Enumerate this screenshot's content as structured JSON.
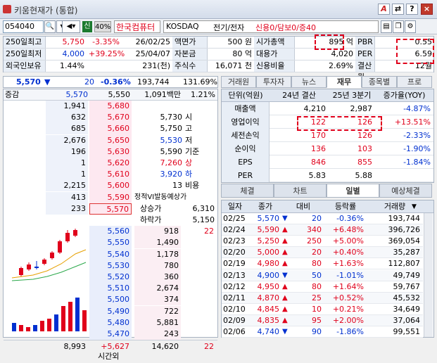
{
  "window": {
    "title": "키움현재가 (통합)",
    "buttons": [
      "A",
      "?",
      "×"
    ]
  },
  "toolbar": {
    "code": "054040",
    "market_tag": "신",
    "margin": "40%",
    "name": "한국컴퓨터",
    "market": "KOSDAQ",
    "sector": "전기/전자",
    "credit": "신용0/담보0/증40"
  },
  "info_rows": [
    {
      "c1": "250일최고",
      "c2": "5,750",
      "c3": "-3.35%",
      "c4": "26/02/25",
      "c5": "액면가",
      "c6": "500 원",
      "c7": "시가총액",
      "c8": "895 억",
      "c9": "PBR",
      "c10": "0.55"
    },
    {
      "c1": "250일최저",
      "c2": "4,000",
      "c3": "+39.25%",
      "c4": "25/04/07",
      "c5": "자본금",
      "c6": "80 억",
      "c7": "대용가",
      "c8": "4,020",
      "c9": "PER",
      "c10": "6.59"
    },
    {
      "c1": "외국인보유",
      "c2": "1.44%",
      "c3": "",
      "c4": "231(천)",
      "c5": "주식수",
      "c6": "16,071 천",
      "c7": "신용비율",
      "c8": "2.69%",
      "c9": "결산월",
      "c10": "12월"
    }
  ],
  "price_bar": {
    "price": "5,570",
    "arrow": "▼",
    "change": "20",
    "rate": "-0.36%",
    "volume": "193,744",
    "vol_rate": "131.69%"
  },
  "orderbook": {
    "head": [
      "증감",
      "5,570",
      "5,550",
      "1,091백만",
      "1.21%"
    ],
    "sells": [
      {
        "qty": "1,941",
        "price": "5,680"
      },
      {
        "qty": "632",
        "price": "5,670"
      },
      {
        "qty": "685",
        "price": "5,660"
      },
      {
        "qty": "2,676",
        "price": "5,650"
      },
      {
        "qty": "196",
        "price": "5,630"
      },
      {
        "qty": "1",
        "price": "5,620"
      },
      {
        "qty": "1",
        "price": "5,610"
      },
      {
        "qty": "2,215",
        "price": "5,600"
      },
      {
        "qty": "413",
        "price": "5,590"
      },
      {
        "qty": "233",
        "price": "5,570"
      }
    ],
    "summary": [
      {
        "label": "시",
        "value": "5,730"
      },
      {
        "label": "고",
        "value": "5,750"
      },
      {
        "label": "저",
        "value": "5,530"
      },
      {
        "label": "기준",
        "value": "5,590"
      },
      {
        "label": "상",
        "value": "7,260"
      },
      {
        "label": "하",
        "value": "3,920"
      },
      {
        "label": "비용",
        "value": "13"
      }
    ],
    "vi": {
      "title": "정적VI발동예상가",
      "up_label": "상승가",
      "up": "6,310",
      "down_label": "하락가",
      "down": "5,150"
    },
    "buys": [
      {
        "price": "5,560",
        "qty": "918",
        "extra": "22"
      },
      {
        "price": "5,550",
        "qty": "1,490",
        "extra": ""
      },
      {
        "price": "5,540",
        "qty": "1,178",
        "extra": ""
      },
      {
        "price": "5,530",
        "qty": "780",
        "extra": ""
      },
      {
        "price": "5,520",
        "qty": "360",
        "extra": ""
      },
      {
        "price": "5,510",
        "qty": "2,674",
        "extra": ""
      },
      {
        "price": "5,500",
        "qty": "374",
        "extra": ""
      },
      {
        "price": "5,490",
        "qty": "722",
        "extra": ""
      },
      {
        "price": "5,480",
        "qty": "5,881",
        "extra": ""
      },
      {
        "price": "5,470",
        "qty": "243",
        "extra": ""
      }
    ],
    "footer": {
      "sell_total": "8,993",
      "diff": "+5,627",
      "buy_total": "14,620",
      "extra": "22",
      "after": "시간외"
    }
  },
  "right_tabs": [
    "거래원",
    "투자자",
    "뉴스",
    "재무",
    "종목별",
    "프로"
  ],
  "fin": {
    "headers": [
      "단위(억원)",
      "24년 결산",
      "25년 3분기",
      "증가율(YOY)"
    ],
    "rows": [
      {
        "name": "매출액",
        "a": "4,210",
        "b": "2,987",
        "c": "-4.87%"
      },
      {
        "name": "영업이익",
        "a": "122",
        "b": "126",
        "c": "+13.51%"
      },
      {
        "name": "세전손익",
        "a": "170",
        "b": "126",
        "c": "-2.33%"
      },
      {
        "name": "순이익",
        "a": "136",
        "b": "103",
        "c": "-1.90%"
      },
      {
        "name": "EPS",
        "a": "846",
        "b": "855",
        "c": "-1.84%"
      },
      {
        "name": "PER",
        "a": "5.83",
        "b": "5.88",
        "c": ""
      }
    ]
  },
  "bottom_tabs": [
    "체결",
    "차트",
    "일별",
    "예상체결"
  ],
  "daily": {
    "headers": [
      "일자",
      "종가",
      "대비",
      "등락률",
      "거래량"
    ],
    "rows": [
      {
        "d": "02/25",
        "p": "5,570",
        "dir": "▼",
        "ch": "20",
        "r": "-0.36%",
        "v": "193,744"
      },
      {
        "d": "02/24",
        "p": "5,590",
        "dir": "▲",
        "ch": "340",
        "r": "+6.48%",
        "v": "396,726"
      },
      {
        "d": "02/23",
        "p": "5,250",
        "dir": "▲",
        "ch": "250",
        "r": "+5.00%",
        "v": "369,054"
      },
      {
        "d": "02/20",
        "p": "5,000",
        "dir": "▲",
        "ch": "20",
        "r": "+0.40%",
        "v": "35,287"
      },
      {
        "d": "02/19",
        "p": "4,980",
        "dir": "▲",
        "ch": "80",
        "r": "+1.63%",
        "v": "112,807"
      },
      {
        "d": "02/13",
        "p": "4,900",
        "dir": "▼",
        "ch": "50",
        "r": "-1.01%",
        "v": "49,749"
      },
      {
        "d": "02/12",
        "p": "4,950",
        "dir": "▲",
        "ch": "80",
        "r": "+1.64%",
        "v": "59,767"
      },
      {
        "d": "02/11",
        "p": "4,870",
        "dir": "▲",
        "ch": "25",
        "r": "+0.52%",
        "v": "45,532"
      },
      {
        "d": "02/10",
        "p": "4,845",
        "dir": "▲",
        "ch": "10",
        "r": "+0.21%",
        "v": "34,649"
      },
      {
        "d": "02/09",
        "p": "4,835",
        "dir": "▲",
        "ch": "95",
        "r": "+2.00%",
        "v": "37,064"
      },
      {
        "d": "02/06",
        "p": "4,740",
        "dir": "▼",
        "ch": "90",
        "r": "-1.86%",
        "v": "99,551"
      }
    ]
  }
}
